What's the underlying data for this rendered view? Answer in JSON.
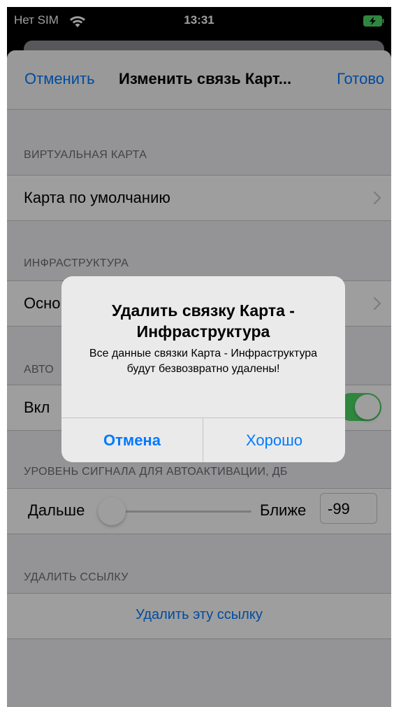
{
  "status_bar": {
    "carrier": "Нет SIM",
    "time": "13:31",
    "wifi_icon": "wifi-icon",
    "battery_icon": "battery-charging-icon"
  },
  "nav": {
    "cancel_label": "Отменить",
    "title": "Изменить связь Карт...",
    "done_label": "Готово"
  },
  "sections": {
    "virtual_map": {
      "header": "ВИРТУАЛЬНАЯ КАРТА",
      "row_label": "Карта по умолчанию"
    },
    "infrastructure": {
      "header": "ИНФРАСТРУКТУРА",
      "row_label": "Основ"
    },
    "auto": {
      "header": "АВТО",
      "row_label": "Вкл",
      "switch_on": true
    },
    "signal": {
      "header": "УРОВЕНЬ СИГНАЛА ДЛЯ АВТОАКТИВАЦИИ, ДБ",
      "left_label": "Дальше",
      "right_label": "Ближе",
      "value": "-99",
      "slider_level": 0
    },
    "delete": {
      "header": "УДАЛИТЬ ССЫЛКУ",
      "button_label": "Удалить эту ссылку"
    }
  },
  "alert": {
    "title": "Удалить связку Карта - Инфраструктура",
    "message": "Все данные связки Карта - Инфраструктура будут безвозвратно удалены!",
    "cancel_label": "Отмена",
    "ok_label": "Хорошо"
  },
  "colors": {
    "accent": "#007aff",
    "switch_on": "#4cd964",
    "grouped_background": "#efeff4"
  }
}
